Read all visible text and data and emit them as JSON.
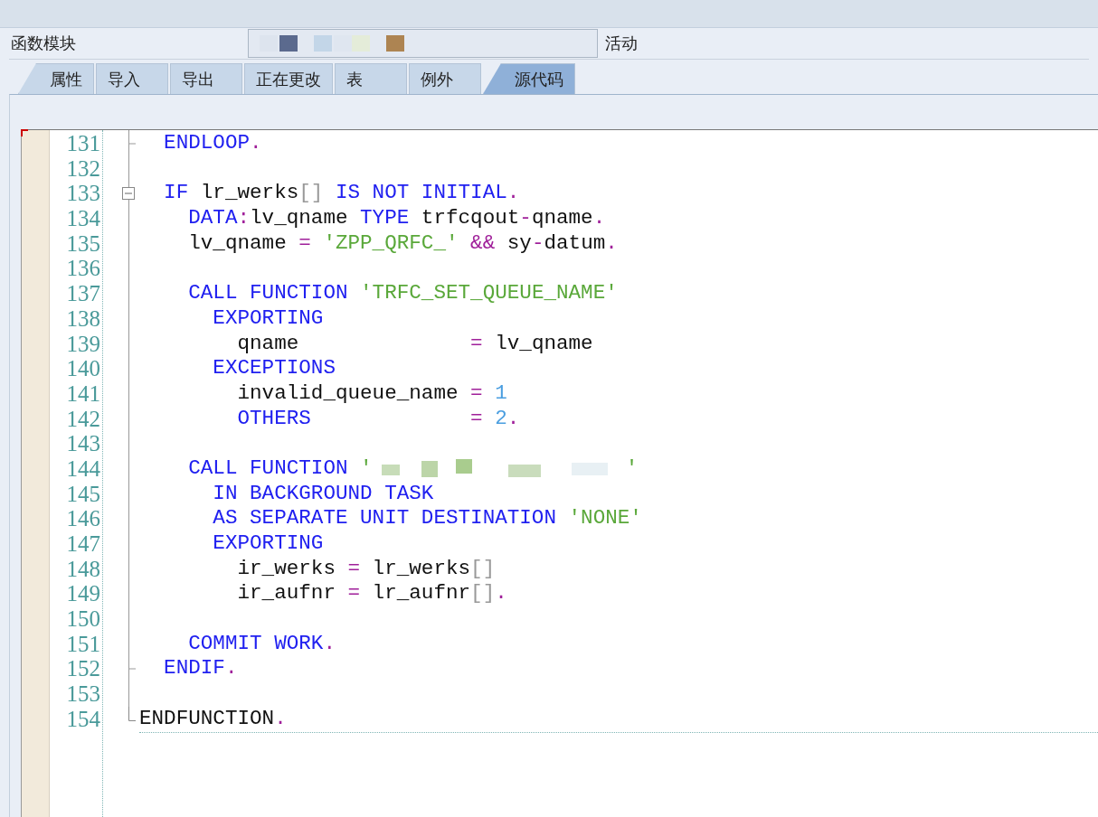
{
  "header": {
    "label": "函数模块",
    "status": "活动"
  },
  "tabs": [
    {
      "label": "属性",
      "selected": false
    },
    {
      "label": "导入",
      "selected": false
    },
    {
      "label": "导出",
      "selected": false
    },
    {
      "label": "正在更改",
      "selected": false
    },
    {
      "label": "表",
      "selected": false
    },
    {
      "label": "例外",
      "selected": false
    },
    {
      "label": "源代码",
      "selected": true
    }
  ],
  "editor": {
    "lines": [
      {
        "number": "131",
        "block_end": true,
        "tokens": [
          {
            "kind": "keyword",
            "text": "  ENDLOOP"
          },
          {
            "kind": "operator",
            "text": "."
          }
        ]
      },
      {
        "number": "132"
      },
      {
        "number": "133",
        "expanded": true,
        "tokens": [
          {
            "kind": "keyword",
            "text": "  IF"
          },
          {
            "kind": "text",
            "text": " lr_werks"
          },
          {
            "kind": "bracket",
            "text": "[]"
          },
          {
            "kind": "keyword",
            "text": " IS NOT INITIAL"
          },
          {
            "kind": "operator",
            "text": "."
          }
        ]
      },
      {
        "number": "134",
        "tokens": [
          {
            "kind": "keyword",
            "text": "    DATA"
          },
          {
            "kind": "operator",
            "text": ":"
          },
          {
            "kind": "text",
            "text": "lv_qname "
          },
          {
            "kind": "keyword",
            "text": "TYPE"
          },
          {
            "kind": "text",
            "text": " trfcqout"
          },
          {
            "kind": "operator",
            "text": "-"
          },
          {
            "kind": "text",
            "text": "qname"
          },
          {
            "kind": "operator",
            "text": "."
          }
        ]
      },
      {
        "number": "135",
        "tokens": [
          {
            "kind": "text",
            "text": "    lv_qname "
          },
          {
            "kind": "operator",
            "text": "= "
          },
          {
            "kind": "string",
            "text": "'ZPP_QRFC_' "
          },
          {
            "kind": "operator",
            "text": "&&"
          },
          {
            "kind": "text",
            "text": " sy"
          },
          {
            "kind": "operator",
            "text": "-"
          },
          {
            "kind": "text",
            "text": "datum"
          },
          {
            "kind": "operator",
            "text": "."
          }
        ]
      },
      {
        "number": "136"
      },
      {
        "number": "137",
        "tokens": [
          {
            "kind": "keyword",
            "text": "    CALL FUNCTION"
          },
          {
            "kind": "string",
            "text": " 'TRFC_SET_QUEUE_NAME'"
          }
        ]
      },
      {
        "number": "138",
        "tokens": [
          {
            "kind": "keyword",
            "text": "      EXPORTING"
          }
        ]
      },
      {
        "number": "139",
        "tokens": [
          {
            "kind": "text",
            "text": "        qname              "
          },
          {
            "kind": "operator",
            "text": "="
          },
          {
            "kind": "text",
            "text": " lv_qname"
          }
        ]
      },
      {
        "number": "140",
        "tokens": [
          {
            "kind": "keyword",
            "text": "      EXCEPTIONS"
          }
        ]
      },
      {
        "number": "141",
        "tokens": [
          {
            "kind": "text",
            "text": "        invalid_queue_name "
          },
          {
            "kind": "operator",
            "text": "= "
          },
          {
            "kind": "number",
            "text": "1"
          }
        ]
      },
      {
        "number": "142",
        "tokens": [
          {
            "kind": "keyword",
            "text": "        OTHERS             "
          },
          {
            "kind": "operator",
            "text": "= "
          },
          {
            "kind": "number",
            "text": "2"
          },
          {
            "kind": "operator",
            "text": "."
          }
        ]
      },
      {
        "number": "143"
      },
      {
        "number": "144",
        "tokens": [
          {
            "kind": "keyword",
            "text": "    CALL FUNCTION"
          },
          {
            "kind": "string",
            "text": " '"
          },
          {
            "kind": "redacted"
          },
          {
            "kind": "string",
            "text": "'"
          }
        ]
      },
      {
        "number": "145",
        "tokens": [
          {
            "kind": "keyword",
            "text": "      IN BACKGROUND TASK"
          }
        ]
      },
      {
        "number": "146",
        "tokens": [
          {
            "kind": "keyword",
            "text": "      AS SEPARATE UNIT DESTINATION"
          },
          {
            "kind": "string",
            "text": " 'NONE'"
          }
        ]
      },
      {
        "number": "147",
        "tokens": [
          {
            "kind": "keyword",
            "text": "      EXPORTING"
          }
        ]
      },
      {
        "number": "148",
        "tokens": [
          {
            "kind": "text",
            "text": "        ir_werks "
          },
          {
            "kind": "operator",
            "text": "="
          },
          {
            "kind": "text",
            "text": " lr_werks"
          },
          {
            "kind": "bracket",
            "text": "[]"
          }
        ]
      },
      {
        "number": "149",
        "tokens": [
          {
            "kind": "text",
            "text": "        ir_aufnr "
          },
          {
            "kind": "operator",
            "text": "="
          },
          {
            "kind": "text",
            "text": " lr_aufnr"
          },
          {
            "kind": "bracket",
            "text": "[]"
          },
          {
            "kind": "operator",
            "text": "."
          }
        ]
      },
      {
        "number": "150"
      },
      {
        "number": "151",
        "tokens": [
          {
            "kind": "keyword",
            "text": "    COMMIT WORK"
          },
          {
            "kind": "operator",
            "text": "."
          }
        ]
      },
      {
        "number": "152",
        "block_end": true,
        "tokens": [
          {
            "kind": "keyword",
            "text": "  ENDIF"
          },
          {
            "kind": "operator",
            "text": "."
          }
        ]
      },
      {
        "number": "153"
      },
      {
        "number": "154",
        "block_end": true,
        "tokens": [
          {
            "kind": "text",
            "text": "ENDFUNCTION"
          },
          {
            "kind": "operator",
            "text": "."
          }
        ]
      }
    ]
  }
}
